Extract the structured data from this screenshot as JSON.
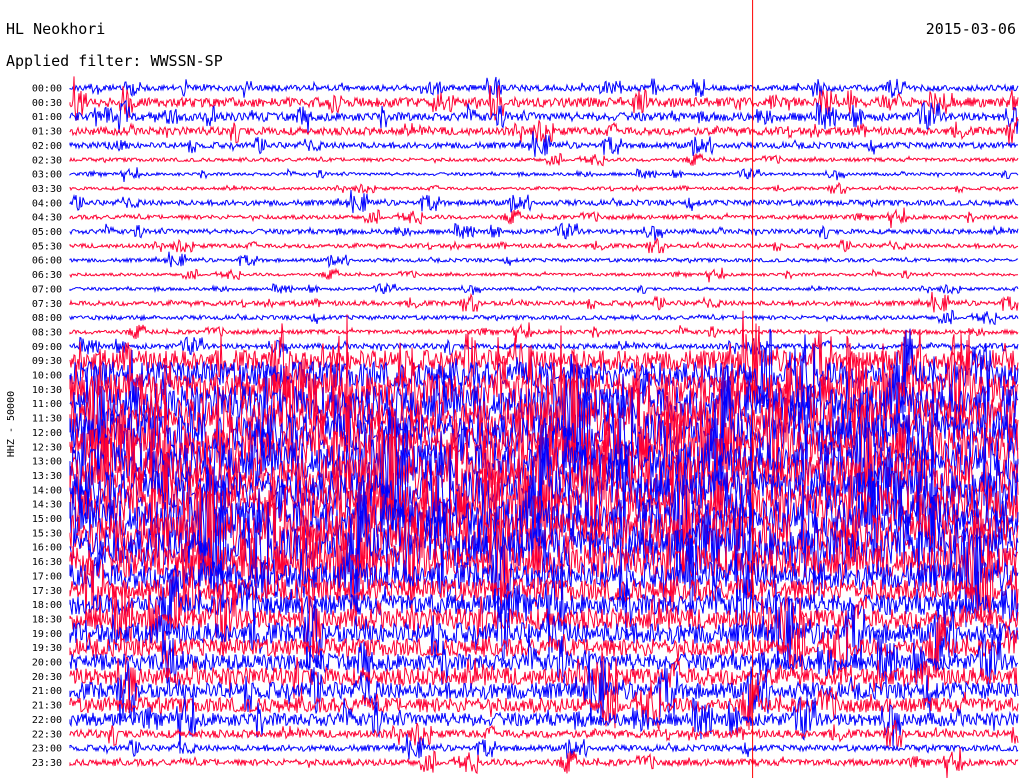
{
  "header": {
    "station": "HL Neokhori",
    "date": "2015-03-06",
    "filter": "Applied filter: WWSSN-SP"
  },
  "chart_data": {
    "type": "line",
    "title": "",
    "ylabel": "HHZ - 50000",
    "xlabel": "",
    "row_labels": [
      "00:00",
      "00:30",
      "01:00",
      "01:30",
      "02:00",
      "02:30",
      "03:00",
      "03:30",
      "04:00",
      "04:30",
      "05:00",
      "05:30",
      "06:00",
      "06:30",
      "07:00",
      "07:30",
      "08:00",
      "08:30",
      "09:00",
      "09:30",
      "10:00",
      "10:30",
      "11:00",
      "11:30",
      "12:00",
      "12:30",
      "13:00",
      "13:30",
      "14:00",
      "14:30",
      "15:00",
      "15:30",
      "16:00",
      "16:30",
      "17:00",
      "17:30",
      "18:00",
      "18:30",
      "19:00",
      "19:30",
      "20:00",
      "20:30",
      "21:00",
      "21:30",
      "22:00",
      "22:30",
      "23:00",
      "23:30"
    ],
    "row_minutes": 30,
    "trace_colors": [
      "#0000ff",
      "#ff0033"
    ],
    "marker_color": "#ff0000",
    "marker_row": "00:00",
    "marker_fraction": 0.72,
    "relative_amplitude": [
      1.0,
      1.6,
      1.4,
      1.3,
      1.0,
      0.6,
      0.5,
      0.5,
      0.9,
      0.7,
      0.8,
      0.7,
      0.6,
      0.5,
      0.5,
      0.8,
      0.7,
      0.7,
      0.9,
      3.5,
      4.5,
      5.5,
      6.0,
      6.5,
      6.5,
      6.5,
      6.5,
      6.5,
      6.5,
      6.5,
      6.5,
      6.5,
      6.5,
      5.5,
      4.5,
      3.8,
      3.5,
      3.5,
      3.5,
      3.0,
      2.8,
      3.0,
      2.8,
      2.5,
      2.2,
      1.3,
      1.0,
      1.1
    ],
    "grid": false,
    "legend": "none"
  }
}
